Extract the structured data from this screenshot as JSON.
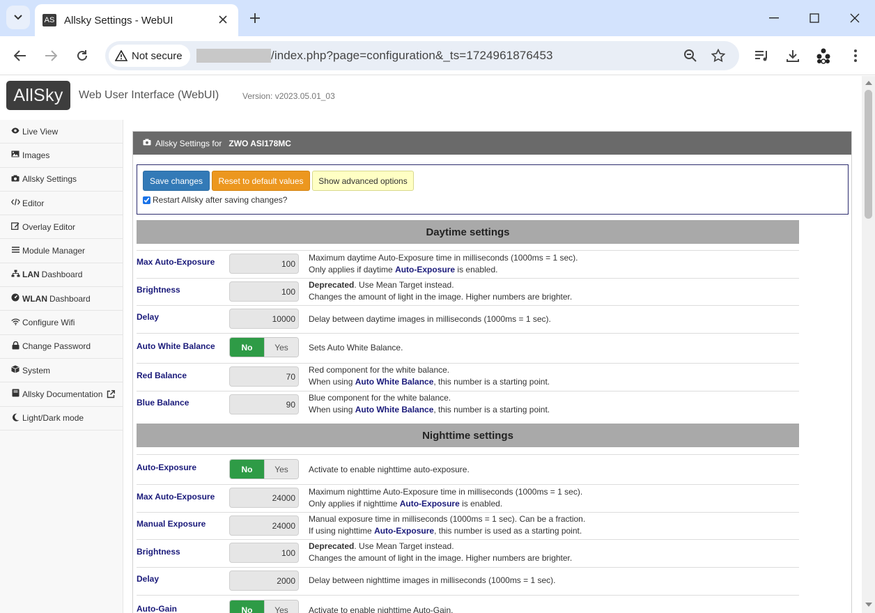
{
  "browser": {
    "tab_title": "Allsky Settings - WebUI",
    "favicon_text": "AS",
    "security_label": "Not secure",
    "url": "/index.php?page=configuration&_ts=1724961876453"
  },
  "header": {
    "logo": "AllSky",
    "app_name": "Web User Interface (WebUI)",
    "version": "Version: v2023.05.01_03"
  },
  "sidebar": {
    "items": [
      {
        "label": "Live View",
        "icon": "eye-icon"
      },
      {
        "label": "Images",
        "icon": "image-icon"
      },
      {
        "label": "Allsky Settings",
        "icon": "camera-icon"
      },
      {
        "label": "Editor",
        "icon": "code-icon"
      },
      {
        "label": "Overlay Editor",
        "icon": "edit-icon"
      },
      {
        "label": "Module Manager",
        "icon": "list-icon"
      },
      {
        "label_bold": "LAN",
        "label": "Dashboard",
        "icon": "network-icon"
      },
      {
        "label_bold": "WLAN",
        "label": "Dashboard",
        "icon": "dashboard-icon"
      },
      {
        "label": "Configure Wifi",
        "icon": "wifi-icon"
      },
      {
        "label": "Change Password",
        "icon": "lock-icon"
      },
      {
        "label": "System",
        "icon": "cube-icon"
      },
      {
        "label": "Allsky Documentation",
        "icon": "book-icon"
      },
      {
        "label": "Light/Dark mode",
        "icon": "moon-icon"
      }
    ]
  },
  "panel": {
    "title_prefix": "Allsky Settings for",
    "camera_model": "ZWO ASI178MC"
  },
  "actions": {
    "save": "Save changes",
    "reset": "Reset to default values",
    "advanced": "Show advanced options",
    "restart_label": "Restart Allsky after saving changes?",
    "restart_checked": true
  },
  "daytime": {
    "heading": "Daytime settings",
    "max_auto_exposure": {
      "label": "Max Auto-Exposure",
      "value": "100",
      "desc1": "Maximum daytime Auto-Exposure time in milliseconds (1000ms = 1 sec).",
      "desc2_pre": "Only applies if daytime ",
      "desc2_kw": "Auto-Exposure",
      "desc2_post": " is enabled."
    },
    "brightness": {
      "label": "Brightness",
      "value": "100",
      "desc1_dep": "Deprecated",
      "desc1": ". Use Mean Target instead.",
      "desc2": "Changes the amount of light in the image. Higher numbers are brighter."
    },
    "delay": {
      "label": "Delay",
      "value": "10000",
      "desc1": "Delay between daytime images in milliseconds (1000ms = 1 sec)."
    },
    "auto_white_balance": {
      "label": "Auto White Balance",
      "on": "No",
      "off": "Yes",
      "desc1": "Sets Auto White Balance."
    },
    "red_balance": {
      "label": "Red Balance",
      "value": "70",
      "desc1": "Red component for the white balance.",
      "desc2_pre": "When using ",
      "desc2_kw": "Auto White Balance",
      "desc2_post": ", this number is a starting point."
    },
    "blue_balance": {
      "label": "Blue Balance",
      "value": "90",
      "desc1": "Blue component for the white balance.",
      "desc2_pre": "When using ",
      "desc2_kw": "Auto White Balance",
      "desc2_post": ", this number is a starting point."
    }
  },
  "nighttime": {
    "heading": "Nighttime settings",
    "auto_exposure": {
      "label": "Auto-Exposure",
      "on": "No",
      "off": "Yes",
      "desc1": "Activate to enable nighttime auto-exposure."
    },
    "max_auto_exposure": {
      "label": "Max Auto-Exposure",
      "value": "24000",
      "desc1": "Maximum nighttime Auto-Exposure time in milliseconds (1000ms = 1 sec).",
      "desc2_pre": "Only applies if nighttime ",
      "desc2_kw": "Auto-Exposure",
      "desc2_post": " is enabled."
    },
    "manual_exposure": {
      "label": "Manual Exposure",
      "value": "24000",
      "desc1": "Manual exposure time in milliseconds (1000ms = 1 sec). Can be a fraction.",
      "desc2_pre": "If using nighttime ",
      "desc2_kw": "Auto-Exposure",
      "desc2_post": ", this number is used as a starting point."
    },
    "brightness": {
      "label": "Brightness",
      "value": "100",
      "desc1_dep": "Deprecated",
      "desc1": ". Use Mean Target instead.",
      "desc2": "Changes the amount of light in the image. Higher numbers are brighter."
    },
    "delay": {
      "label": "Delay",
      "value": "2000",
      "desc1": "Delay between nighttime images in milliseconds (1000ms = 1 sec)."
    },
    "auto_gain": {
      "label": "Auto-Gain",
      "on": "No",
      "off": "Yes",
      "desc1": "Activate to enable nighttime Auto-Gain."
    }
  }
}
